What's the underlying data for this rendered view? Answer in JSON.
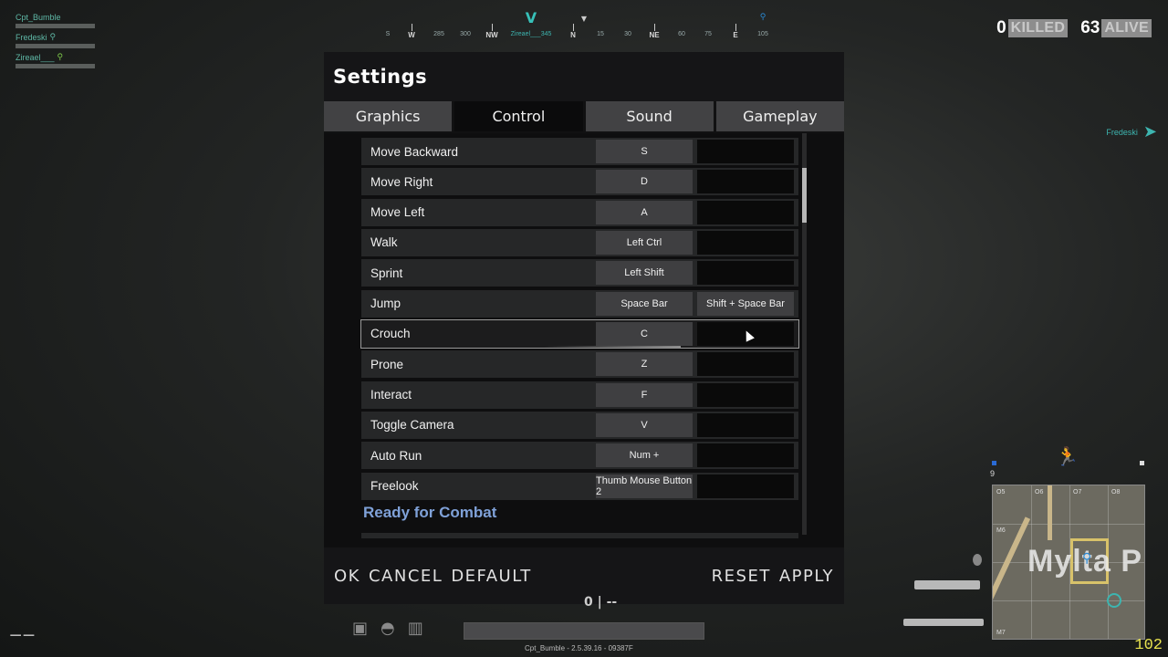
{
  "squad": [
    {
      "name": "Cpt_Bumble",
      "pin": ""
    },
    {
      "name": "Fredeski",
      "pin": "⚲"
    },
    {
      "name": "Zireael___",
      "pin": "⚲"
    }
  ],
  "compass": {
    "labels": [
      "S",
      "W",
      "285",
      "300",
      "NW",
      "Zireael___345",
      "N",
      "15",
      "30",
      "NE",
      "60",
      "75",
      "E",
      "105"
    ]
  },
  "counter": {
    "killed_num": "0",
    "killed_label": "KILLED",
    "alive_num": "63",
    "alive_label": "ALIVE"
  },
  "teammate_indicator": "Fredeski",
  "settings": {
    "title": "Settings",
    "tabs": [
      "Graphics",
      "Control",
      "Sound",
      "Gameplay"
    ],
    "active_tab": "Control",
    "bindings": [
      {
        "action": "Move Backward",
        "key1": "S",
        "key2": ""
      },
      {
        "action": "Move Right",
        "key1": "D",
        "key2": ""
      },
      {
        "action": "Move Left",
        "key1": "A",
        "key2": ""
      },
      {
        "action": "Walk",
        "key1": "Left Ctrl",
        "key2": ""
      },
      {
        "action": "Sprint",
        "key1": "Left Shift",
        "key2": ""
      },
      {
        "action": "Jump",
        "key1": "Space Bar",
        "key2": "Shift + Space Bar"
      },
      {
        "action": "Crouch",
        "key1": "C",
        "key2": ""
      },
      {
        "action": "Prone",
        "key1": "Z",
        "key2": ""
      },
      {
        "action": "Interact",
        "key1": "F",
        "key2": ""
      },
      {
        "action": "Toggle Camera",
        "key1": "V",
        "key2": ""
      },
      {
        "action": "Auto Run",
        "key1": "Num +",
        "key2": ""
      },
      {
        "action": "Freelook",
        "key1": "Thumb Mouse Button 2",
        "key2": ""
      }
    ],
    "selected_row": "Crouch",
    "section_heading": "Ready for Combat",
    "footer_left": [
      "OK",
      "CANCEL",
      "DEFAULT"
    ],
    "footer_right": [
      "RESET",
      "APPLY"
    ]
  },
  "hud": {
    "build_info": "Cpt_Bumble - 2.5.39.16 - 09387F",
    "minimap_label": "Mylta P",
    "minimap_coords": [
      "O5",
      "O6",
      "O7",
      "O8",
      "M6",
      "M7"
    ],
    "team_count": "9",
    "fps": "102",
    "center_ammo": "0 | --"
  },
  "colors": {
    "accent_teal": "#3db5b0",
    "section_blue": "#7fa1d8",
    "fps_yellow": "#e9e34f"
  }
}
